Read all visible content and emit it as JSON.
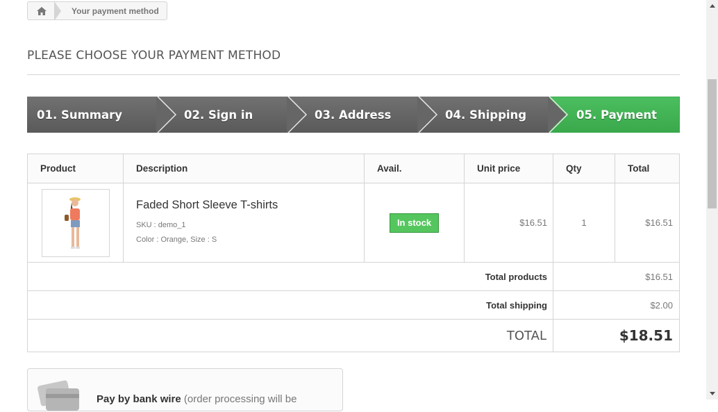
{
  "breadcrumb": {
    "home_icon": "home-icon",
    "current": "Your payment method"
  },
  "heading": "PLEASE CHOOSE YOUR PAYMENT METHOD",
  "steps": [
    {
      "label": "01. Summary",
      "state": "done"
    },
    {
      "label": "02. Sign in",
      "state": "done"
    },
    {
      "label": "03. Address",
      "state": "done"
    },
    {
      "label": "04. Shipping",
      "state": "done"
    },
    {
      "label": "05. Payment",
      "state": "current"
    }
  ],
  "table": {
    "headers": [
      "Product",
      "Description",
      "Avail.",
      "Unit price",
      "Qty",
      "Total"
    ],
    "rows": [
      {
        "name": "Faded Short Sleeve T-shirts",
        "sku": "SKU : demo_1",
        "attributes": "Color : Orange, Size : S",
        "availability": "In stock",
        "unit_price": "$16.51",
        "qty": "1",
        "total": "$16.51"
      }
    ],
    "summary": {
      "total_products_label": "Total products",
      "total_products": "$16.51",
      "total_shipping_label": "Total shipping",
      "total_shipping": "$2.00",
      "total_label": "TOTAL",
      "total": "$18.51"
    }
  },
  "payment_option": {
    "title": "Pay by bank wire",
    "subtitle": "(order processing will be",
    "icon": "bank-card-icon"
  },
  "colors": {
    "step_done": "#5f5e5e",
    "step_current": "#43b155",
    "in_stock": "#55c65e",
    "border": "#d6d4d4"
  }
}
